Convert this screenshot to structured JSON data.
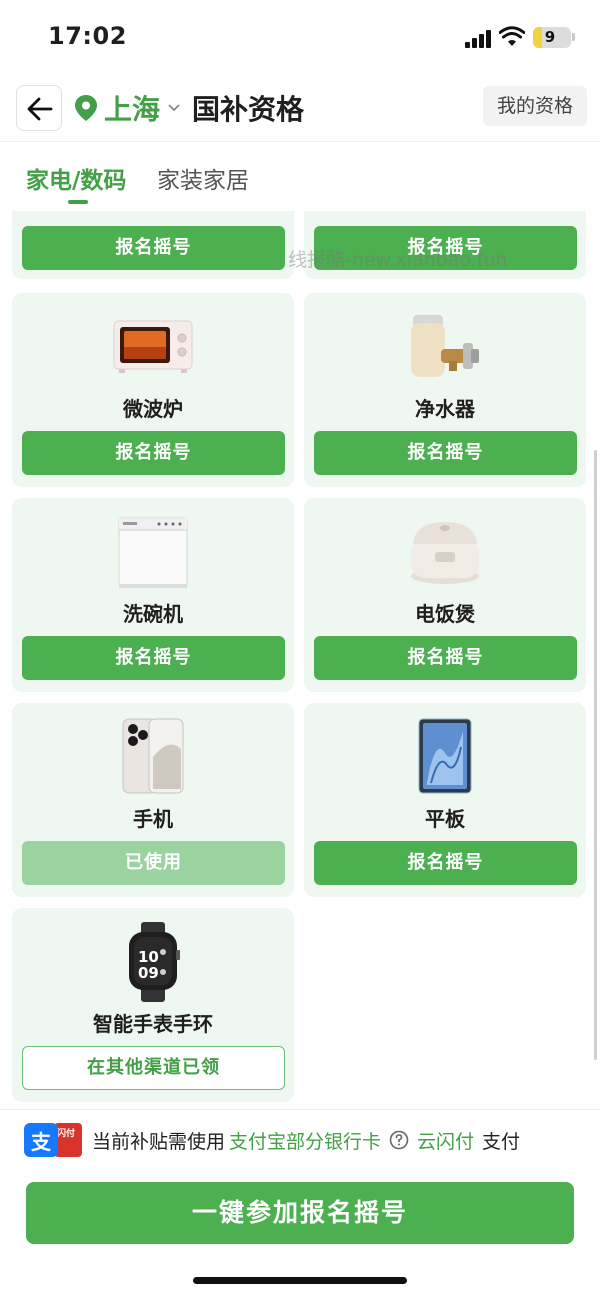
{
  "status_bar": {
    "time": "17:02",
    "battery": "9"
  },
  "header": {
    "city": "上海",
    "title": "国补资格",
    "my_qualification": "我的资格"
  },
  "tabs": [
    {
      "label": "家电/数码",
      "active": true
    },
    {
      "label": "家装家居",
      "active": false
    }
  ],
  "watermark": "线报酷-new.xianbao.fun",
  "products": [
    {
      "name": "",
      "action": "报名摇号",
      "state": "available",
      "icon": "hidden-item"
    },
    {
      "name": "",
      "action": "报名摇号",
      "state": "available",
      "icon": "hidden-item"
    },
    {
      "name": "微波炉",
      "action": "报名摇号",
      "state": "available",
      "icon": "microwave-icon"
    },
    {
      "name": "净水器",
      "action": "报名摇号",
      "state": "available",
      "icon": "water-purifier-icon"
    },
    {
      "name": "洗碗机",
      "action": "报名摇号",
      "state": "available",
      "icon": "dishwasher-icon"
    },
    {
      "name": "电饭煲",
      "action": "报名摇号",
      "state": "available",
      "icon": "rice-cooker-icon"
    },
    {
      "name": "手机",
      "action": "已使用",
      "state": "used",
      "icon": "phone-icon"
    },
    {
      "name": "平板",
      "action": "报名摇号",
      "state": "available",
      "icon": "tablet-icon"
    },
    {
      "name": "智能手表手环",
      "action": "在其他渠道已领",
      "state": "claimed-elsewhere",
      "icon": "smartwatch-icon"
    }
  ],
  "payment_notice": {
    "prefix": "当前补贴需使用",
    "method1": "支付宝部分银行卡",
    "method2": "云闪付",
    "suffix": "支付",
    "logo_text": "支",
    "logo_badge": "闪付"
  },
  "cta": "一键参加报名摇号",
  "colors": {
    "primary": "#4caf50",
    "card_bg": "#eef7f0",
    "used": "#9ad2a0"
  }
}
